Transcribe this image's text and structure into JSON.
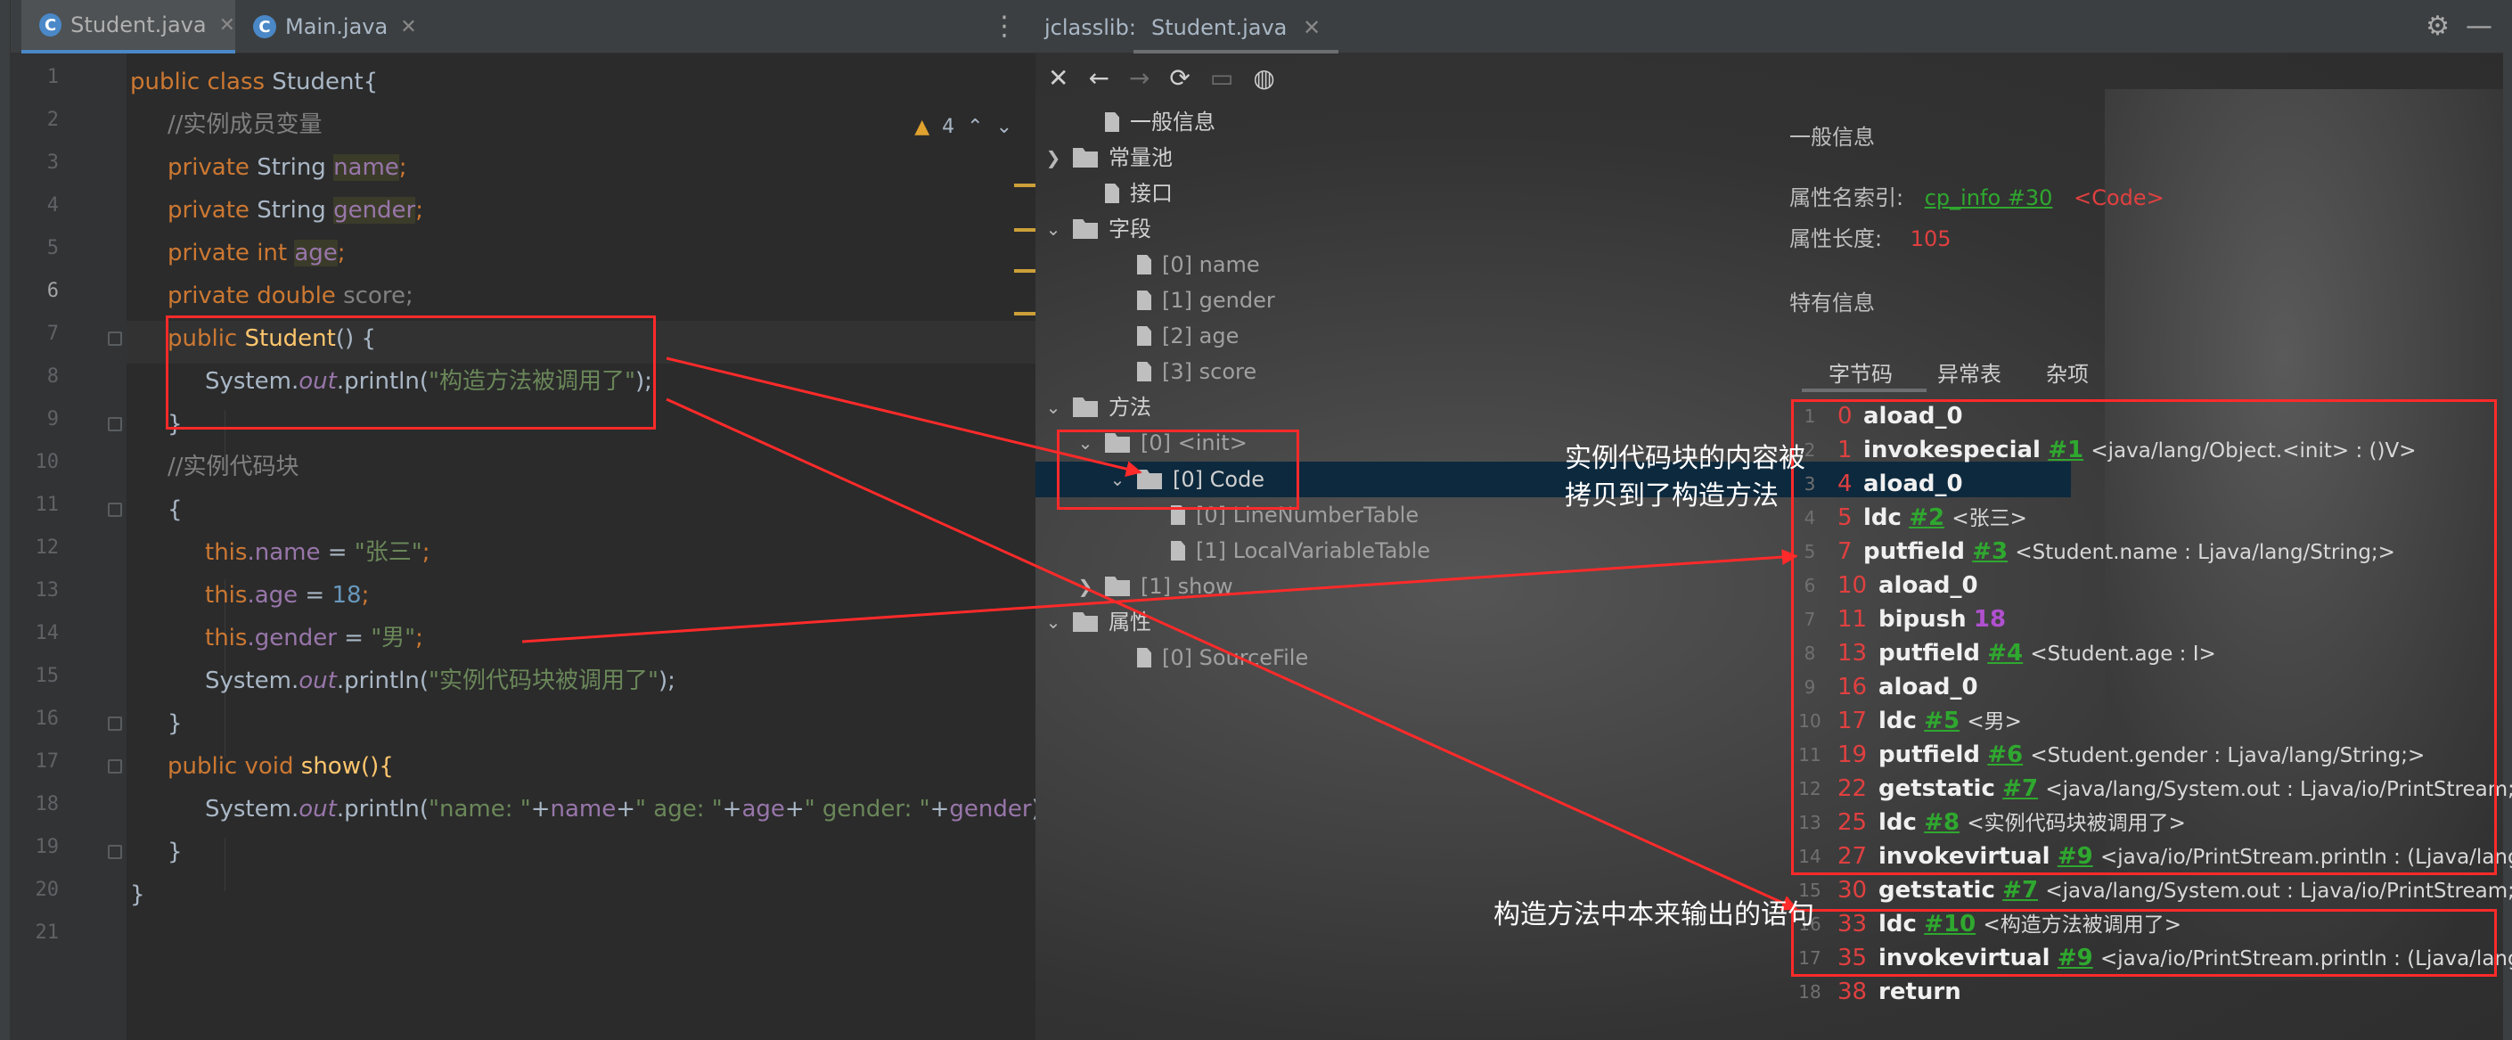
{
  "editor": {
    "tabs": [
      {
        "label": "Student.java",
        "icon": "c"
      },
      {
        "label": "Main.java",
        "icon": "c"
      }
    ],
    "warnings": "4",
    "line_numbers": [
      "1",
      "2",
      "3",
      "4",
      "5",
      "6",
      "7",
      "8",
      "9",
      "10",
      "11",
      "12",
      "13",
      "14",
      "15",
      "16",
      "17",
      "18",
      "19",
      "20",
      "21"
    ],
    "lines": {
      "l1_kw": "public class",
      "l1_rest": " Student{",
      "l2": "//实例成员变量",
      "l3_kw": "private",
      "l3_type": " String ",
      "l3_var": "name",
      "l4_kw": "private",
      "l4_type": " String ",
      "l4_var": "gender",
      "l5_kw": "private int",
      "l5_var": "age",
      "l6_kw": "private double",
      "l6_var": "score;",
      "l7_kw": "public",
      "l7_fn": "Student",
      "l7_rest": "() {",
      "l8_a": "System.",
      "l8_out": "out",
      "l8_b": ".println(",
      "l8_str": "\"构造方法被调用了\"",
      "l8_c": ");",
      "l9": "}",
      "l10": "//实例代码块",
      "l11": "{",
      "l12_this": "this",
      "l12_fld": ".name",
      "l12_eq": " = ",
      "l12_str": "\"张三\"",
      "l12_end": ";",
      "l13_this": "this",
      "l13_fld": ".age",
      "l13_eq": " = ",
      "l13_num": "18",
      "l13_end": ";",
      "l14_this": "this",
      "l14_fld": ".gender",
      "l14_eq": " = ",
      "l14_str": "\"男\"",
      "l14_end": ";",
      "l15_a": "System.",
      "l15_out": "out",
      "l15_b": ".println(",
      "l15_str": "\"实例代码块被调用了\"",
      "l15_c": ");",
      "l16": "}",
      "l17_kw": "public void",
      "l17_fn": " show(){",
      "l18_a": "System.",
      "l18_out": "out",
      "l18_b": ".println(",
      "l18_s1": "\"name: \"",
      "l18_p1": "+",
      "l18_v1": "name",
      "l18_p2": "+",
      "l18_s2": "\" age: \"",
      "l18_p3": "+",
      "l18_v2": "age",
      "l18_p4": "+",
      "l18_s3": "\" gender: \"",
      "l18_p5": "+",
      "l18_v3": "gender",
      "l18_c": ");",
      "l19": "}",
      "l20": "}"
    }
  },
  "jclasslib": {
    "title": "jclasslib:",
    "tab": "Student.java",
    "tree": {
      "general": "一般信息",
      "constant_pool": "常量池",
      "interfaces": "接口",
      "fields": "字段",
      "field_items": [
        "[0] name",
        "[1] gender",
        "[2] age",
        "[3] score"
      ],
      "methods": "方法",
      "init": "[0] <init>",
      "code": "[0] Code",
      "code_children": [
        "[0] LineNumberTable",
        "[1] LocalVariableTable"
      ],
      "show": "[1] show",
      "attributes": "属性",
      "source_file": "[0] SourceFile"
    },
    "detail": {
      "general_header": "一般信息",
      "attr_name_label": "属性名索引:",
      "attr_name_link": "cp_info #30",
      "attr_name_val": "<Code>",
      "attr_len_label": "属性长度:",
      "attr_len_val": "105",
      "specific_header": "特有信息",
      "subtabs": [
        "字节码",
        "异常表",
        "杂项"
      ]
    },
    "bytecode": [
      {
        "line": "1",
        "off": "0",
        "op": "aload_0",
        "ref": "",
        "arg": ""
      },
      {
        "line": "2",
        "off": "1",
        "op": "invokespecial",
        "ref": "#1",
        "arg": "<java/lang/Object.<init> : ()V>"
      },
      {
        "line": "3",
        "off": "4",
        "op": "aload_0",
        "ref": "",
        "arg": ""
      },
      {
        "line": "4",
        "off": "5",
        "op": "ldc",
        "ref": "#2",
        "arg": "<张三>"
      },
      {
        "line": "5",
        "off": "7",
        "op": "putfield",
        "ref": "#3",
        "arg": "<Student.name : Ljava/lang/String;>"
      },
      {
        "line": "6",
        "off": "10",
        "op": "aload_0",
        "ref": "",
        "arg": ""
      },
      {
        "line": "7",
        "off": "11",
        "op": "bipush",
        "ref": "",
        "arg": "",
        "num": "18"
      },
      {
        "line": "8",
        "off": "13",
        "op": "putfield",
        "ref": "#4",
        "arg": "<Student.age : I>"
      },
      {
        "line": "9",
        "off": "16",
        "op": "aload_0",
        "ref": "",
        "arg": ""
      },
      {
        "line": "10",
        "off": "17",
        "op": "ldc",
        "ref": "#5",
        "arg": "<男>"
      },
      {
        "line": "11",
        "off": "19",
        "op": "putfield",
        "ref": "#6",
        "arg": "<Student.gender : Ljava/lang/String;>"
      },
      {
        "line": "12",
        "off": "22",
        "op": "getstatic",
        "ref": "#7",
        "arg": "<java/lang/System.out : Ljava/io/PrintStream;>"
      },
      {
        "line": "13",
        "off": "25",
        "op": "ldc",
        "ref": "#8",
        "arg": "<实例代码块被调用了>"
      },
      {
        "line": "14",
        "off": "27",
        "op": "invokevirtual",
        "ref": "#9",
        "arg": "<java/io/PrintStream.println : (Ljava/lang/Strin"
      },
      {
        "line": "15",
        "off": "30",
        "op": "getstatic",
        "ref": "#7",
        "arg": "<java/lang/System.out : Ljava/io/PrintStream;>"
      },
      {
        "line": "16",
        "off": "33",
        "op": "ldc",
        "ref": "#10",
        "arg": "<构造方法被调用了>"
      },
      {
        "line": "17",
        "off": "35",
        "op": "invokevirtual",
        "ref": "#9",
        "arg": "<java/io/PrintStream.println : (Ljava/lang/Strin"
      },
      {
        "line": "18",
        "off": "38",
        "op": "return",
        "ref": "",
        "arg": ""
      }
    ]
  },
  "annotations": {
    "note1_line1": "实例代码块的内容被",
    "note1_line2": "拷贝到了构造方法",
    "note2": "构造方法中本来输出的语句",
    "color": "#ff2a2a"
  },
  "icons": [
    "java-class-icon",
    "kebab-menu-icon",
    "warning-icon",
    "chevron-up-icon",
    "chevron-down-icon",
    "close-icon",
    "back-arrow-icon",
    "forward-arrow-icon",
    "reload-icon",
    "save-icon",
    "globe-icon",
    "gear-icon",
    "folder-icon",
    "document-icon"
  ]
}
